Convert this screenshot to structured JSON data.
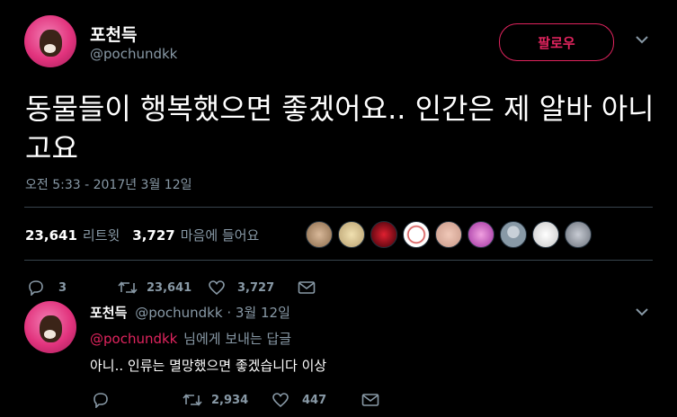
{
  "main_tweet": {
    "author_name": "포천득",
    "author_handle": "@pochundkk",
    "follow_label": "팔로우",
    "text": "동물들이 행복했으면 좋겠어요.. 인간은 제 알바 아니고요",
    "timestamp": "오전 5:33 - 2017년 3월 12일",
    "retweet_count": "23,641",
    "retweet_label": "리트윗",
    "like_count": "3,727",
    "like_label": "마음에 들어요",
    "actions": {
      "reply_count": "3",
      "retweet_count": "23,641",
      "like_count": "3,727"
    }
  },
  "reply_tweet": {
    "author_name": "포천득",
    "author_handle": "@pochundkk",
    "date": "3월 12일",
    "reply_mention": "@pochundkk",
    "reply_suffix": "님에게 보내는 답글",
    "text": "아니.. 인류는 멸망했으면 좋겠습니다 이상",
    "actions": {
      "retweet_count": "2,934",
      "like_count": "447"
    }
  },
  "likers": [
    {
      "color": "#c9a78a"
    },
    {
      "color": "#d8c79a"
    },
    {
      "color": "#c0102a"
    },
    {
      "color": "#f2f2f2"
    },
    {
      "color": "#e8b8a8"
    },
    {
      "color": "#d070c8"
    },
    {
      "color": "#8899a6"
    },
    {
      "color": "#e6e6e6"
    },
    {
      "color": "#9aa0a8"
    }
  ],
  "colors": {
    "background": "#000000",
    "accent": "#e0245e",
    "secondary_text": "#8899a6",
    "divider": "#38444d"
  }
}
